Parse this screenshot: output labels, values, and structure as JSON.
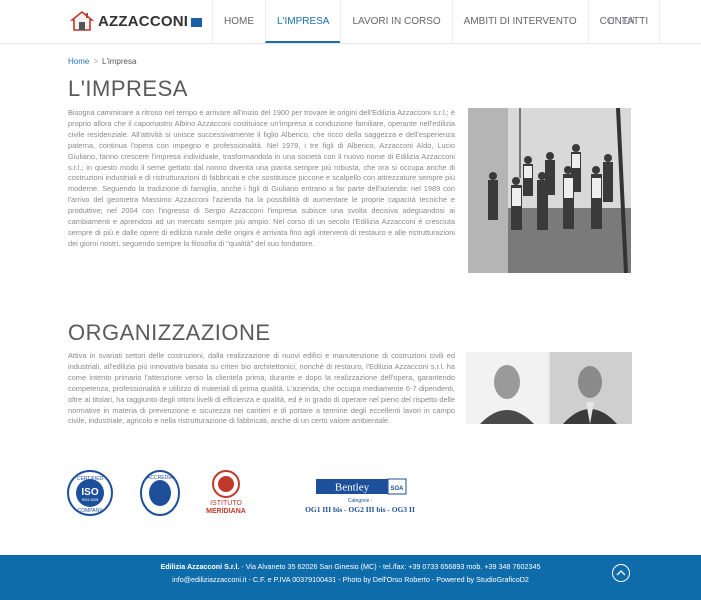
{
  "brand": {
    "name": "AZZACCONI"
  },
  "nav": {
    "items": [
      {
        "label": "HOME"
      },
      {
        "label": "L'IMPRESA"
      },
      {
        "label": "LAVORI IN CORSO"
      },
      {
        "label": "AMBITI DI INTERVENTO"
      },
      {
        "label": "CONTATTI"
      }
    ],
    "active_index": 1,
    "languages": [
      "IT",
      "EN"
    ]
  },
  "breadcrumb": {
    "home": "Home",
    "separator": ">",
    "current": "L'impresa"
  },
  "section_impresa": {
    "title": "L'IMPRESA",
    "text": "Bisogna camminare a  ritroso nel tempo e arrivare all'inizio del  1900 per  trovare le origini dell'Edilizia Azzacconi s.r.l.; è proprio allora che il capomastro Albino Azzacconi  costituisce un'impresa a conduzione familiare, operante nell'edilizia civile residenziale. All'attività si unisce successivamente il figlio Alberico, che ricco della saggezza e dell'esperienza paterna, continua l'opera con impegno e professionalità. Nel 1979, i tre figli di Alberico,  Azzacconi Aldo, Lucio Giuliano, fanno crescere l'impresa  individuale, trasformandola in una  società con il nuovo nome di Edilizia Azzacconi s.r.l.; in questo modo il seme gettato dal nonno  diventa una pianta sempre più robusta, che ora si occupa anche di costruzioni  industriali e di  ristrutturazioni di fabbricati e che  sostituisce piccone e  scalpello con  attrezzature sempre più moderne. Seguendo la tradizione di famiglia, anche i figli di Giuliano entrano a far parte dell'azienda: nel 1989 con l'arrivo del geometra Massimo Azzacconi l'azienda ha la possibilità di aumentare le proprie capacità tecniche e produttive; nel 2004 con l'ingresso di Sergio Azzacconi l'impresa subisce una svolta decisiva adeguandosi ai cambiamenti e aprendosi ad un  mercato sempre più ampio. Nel corso di un secolo l'Edilizia Azzacconi è cresciuta sempre di più e dalle opere di edilizia rurale delle  origini è arrivata fino agli interventi di restauro e alle ristrutturazioni dei giorni nostri, seguendo sempre la filosofia di \"qualità\" del suo fondatore."
  },
  "section_organizzazione": {
    "title": "ORGANIZZAZIONE",
    "text": "Attiva in svariati settori delle costruzioni, dalla realizzazione di nuovi edifici e manutenzione di costruzioni civili ed industriali, all'edilizia più innovativa basata su criteri bio architettonici, nonché di restauro, l'Edilizia Azzacconi s.r.l. ha come intento primario l'attenzione verso la clientela prima, durante e dopo la realizzazione dell'opera, garantendo competenza, professionalità e utilizzo di materiali di prima qualità. L'azienda, che occupa mediamente 6-7 dipendenti, oltre ai titolari, ha raggiunto degli ottimi livelli di efficienza e qualità, ed è in grado di operare nel pieno del rispetto delle normative in materia di prevenzione e sicurezza nei cantieri e di portare a termine degli eccellenti lavori in campo civile, industriale, agricolo e nella ristrutturazione di fabbricati, anche di un certo valore ambientale."
  },
  "certifications": {
    "iso": {
      "top": "CERTIFIED",
      "mid": "ISO",
      "num": "9001:2008",
      "bottom": "COMPANY"
    },
    "accredia": {
      "name": "ACCREDIA"
    },
    "meridiana": {
      "line1": "ISTITUTO",
      "line2": "MERIDIANA"
    },
    "bentley": {
      "name": "Bentley",
      "soa": "SOA",
      "cat_label": "Categorie :",
      "categories": "OG1  III bis - OG2  III bis - OG3  II"
    }
  },
  "footer": {
    "company": "Edilizia Azzacconi S.r.l.",
    "line1": " - Via Alvaneto 35 62026 San Ginesio (MC) - tel./fax: +39 0733 656893 mob. +39 348 7602345",
    "line2": "info@ediliziazzacconi.it - C.F. e P.IVA 00379100431 - Photo by Dell'Orso Roberto - Powered by StudioGraficoD2"
  },
  "colors": {
    "accent": "#1a6fb0",
    "footer_bg": "#0f6cab"
  }
}
